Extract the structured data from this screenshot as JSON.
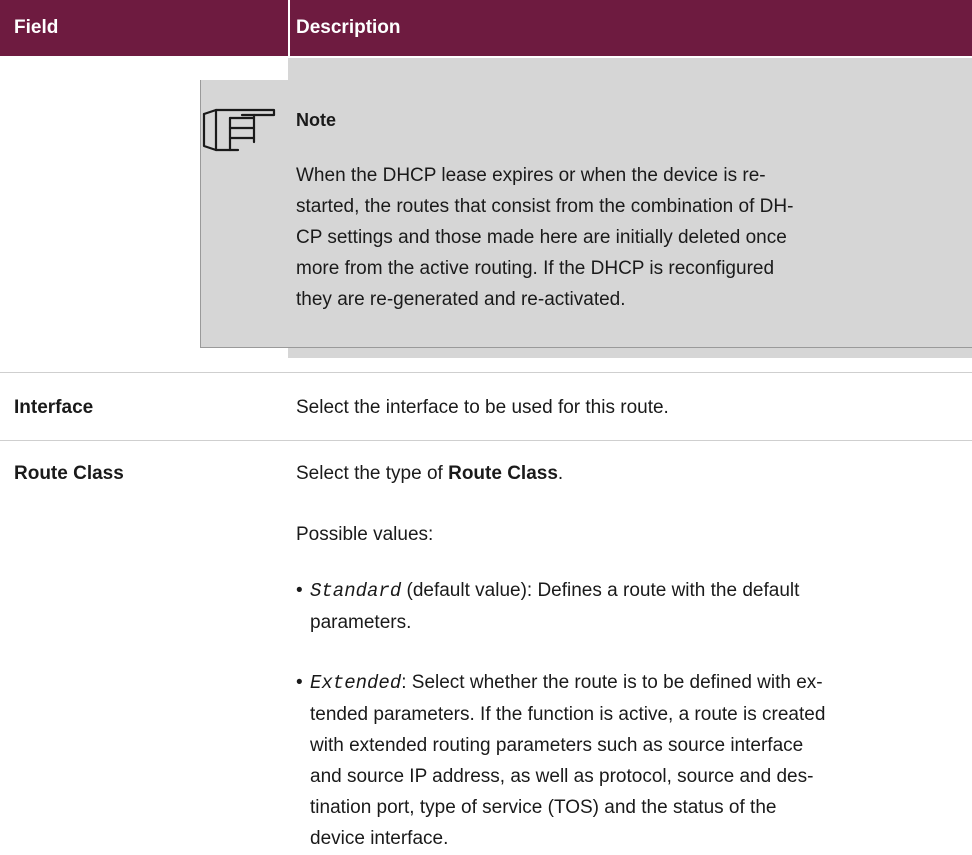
{
  "header": {
    "field_label": "Field",
    "description_label": "Description"
  },
  "note": {
    "title": "Note",
    "lines": [
      "When the DHCP lease expires or when the device is re-",
      "started, the routes that consist from the combination of DH-",
      "CP settings and those made here are initially deleted once",
      "more from the active routing. If the DHCP is reconfigured",
      "they are re-generated and re-activated."
    ],
    "icon": "pointing-hand-icon"
  },
  "interface_row": {
    "label": "Interface",
    "description": "Select the interface to be used for this route."
  },
  "route_class_row": {
    "label": "Route Class",
    "intro_prefix": "Select the type of ",
    "intro_bold": "Route Class",
    "intro_suffix": ".",
    "possible_values": "Possible values:",
    "standard": {
      "term": "Standard",
      "lines": [
        " (default value): Defines a route with the default",
        "parameters."
      ]
    },
    "extended": {
      "term": "Extended",
      "lines": [
        ": Select whether the route is to be defined with ex-",
        "tended parameters. If the function is active, a route is created",
        "with extended routing parameters such as source interface",
        "and source IP address, as well as protocol, source and des-",
        "tination port, type of service (TOS) and the status of the",
        "device interface."
      ]
    }
  }
}
